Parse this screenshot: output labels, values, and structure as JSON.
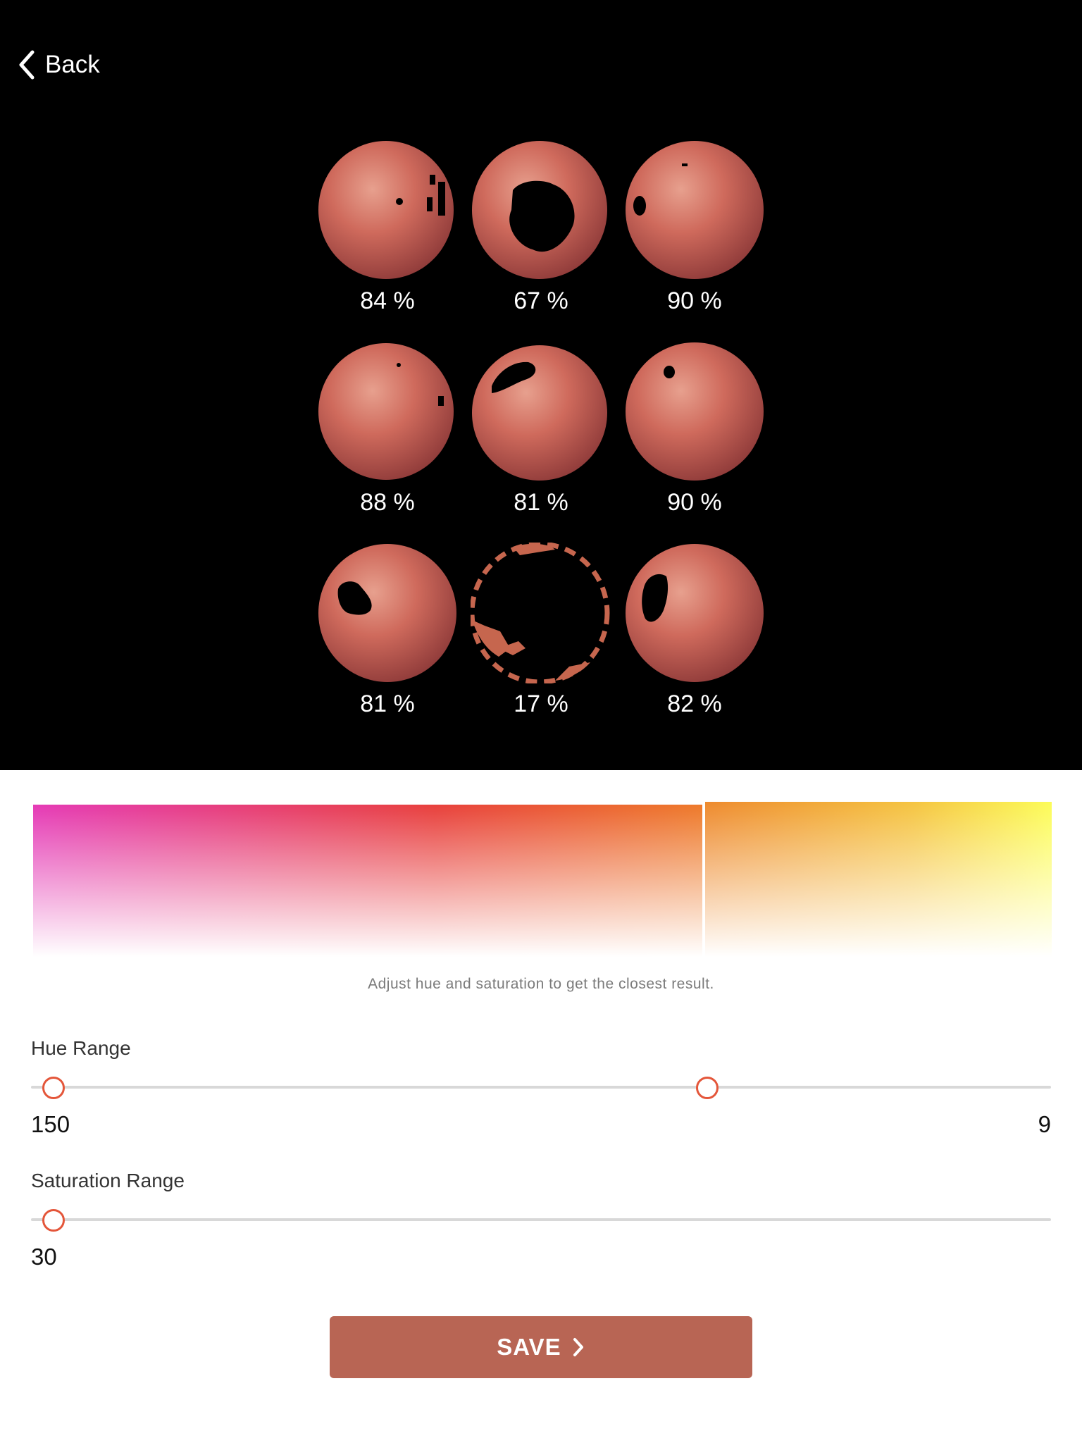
{
  "nav": {
    "back_label": "Back",
    "back_icon": "chevron-left-icon"
  },
  "samples": [
    {
      "percent": "84 %"
    },
    {
      "percent": "67 %"
    },
    {
      "percent": "90 %"
    },
    {
      "percent": "88 %"
    },
    {
      "percent": "81 %"
    },
    {
      "percent": "90 %"
    },
    {
      "percent": "81 %"
    },
    {
      "percent": "17 %"
    },
    {
      "percent": "82 %"
    }
  ],
  "color_preview": {
    "hint": "Adjust hue and saturation to get the closest result.",
    "left_colors": [
      "#e53ab6",
      "#e8403c",
      "#ee7a2a"
    ],
    "right_colors": [
      "#ee8a2e",
      "#f5c441",
      "#fcfc58"
    ]
  },
  "hue_range": {
    "label": "Hue Range",
    "min_value": "150",
    "max_value": "9",
    "min_fraction": 0.022,
    "max_fraction": 0.663
  },
  "saturation_range": {
    "label": "Saturation Range",
    "value": "30",
    "fraction": 0.022
  },
  "save_button": {
    "label": "SAVE",
    "icon": "chevron-right-icon"
  },
  "colors": {
    "accent": "#e4563a",
    "button": "#b86554",
    "top_background": "#000000"
  }
}
